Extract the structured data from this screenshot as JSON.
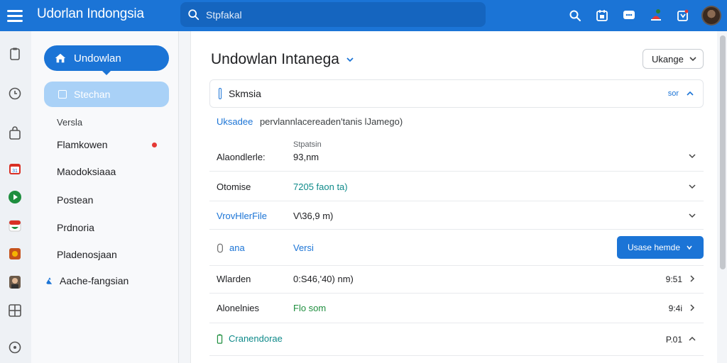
{
  "app": {
    "title": "Udorlan Indongsia"
  },
  "search": {
    "placeholder": "Stpfakal"
  },
  "sidebar": {
    "primary_label": "Undowlan",
    "secondary_label": "Stechan",
    "section_label": "Versla",
    "items": [
      {
        "label": "Flamkowen",
        "has_alert": true
      },
      {
        "label": "Maodoksiaaa"
      },
      {
        "label": "Postean"
      },
      {
        "label": "Prdnoria"
      },
      {
        "label": "Pladenosjaan"
      }
    ],
    "special_label": "Aache-fangsian"
  },
  "main": {
    "title": "Undowlan Intanega",
    "top_select": "Ukange",
    "section": {
      "title": "Skmsia",
      "action": "sor"
    },
    "description": {
      "lead": "Uksadee",
      "text": "pervlannlacereaden'tanis lJamego)"
    },
    "rows": [
      {
        "label": "Alaondlerle:",
        "sub": "Stpatsin",
        "value": "93,nm"
      },
      {
        "label": "Otomise",
        "value": "7205 faon ta)"
      },
      {
        "label": "VrovHlerFile",
        "value": "V\\36,9 m)"
      },
      {
        "label": "ana",
        "value": "Versi"
      },
      {
        "label": "Wlarden",
        "value": "0:S46,'40) nm)",
        "right": "9:51"
      },
      {
        "label": "Alonelnies",
        "value": "Flo som",
        "right": "9:4i"
      },
      {
        "label": "Cranendorae",
        "right": "P.01"
      }
    ],
    "action_button": "Usase hemde"
  },
  "colors": {
    "accent": "#1b74d6",
    "alert": "#e53935",
    "positive": "#1e8e3e"
  }
}
